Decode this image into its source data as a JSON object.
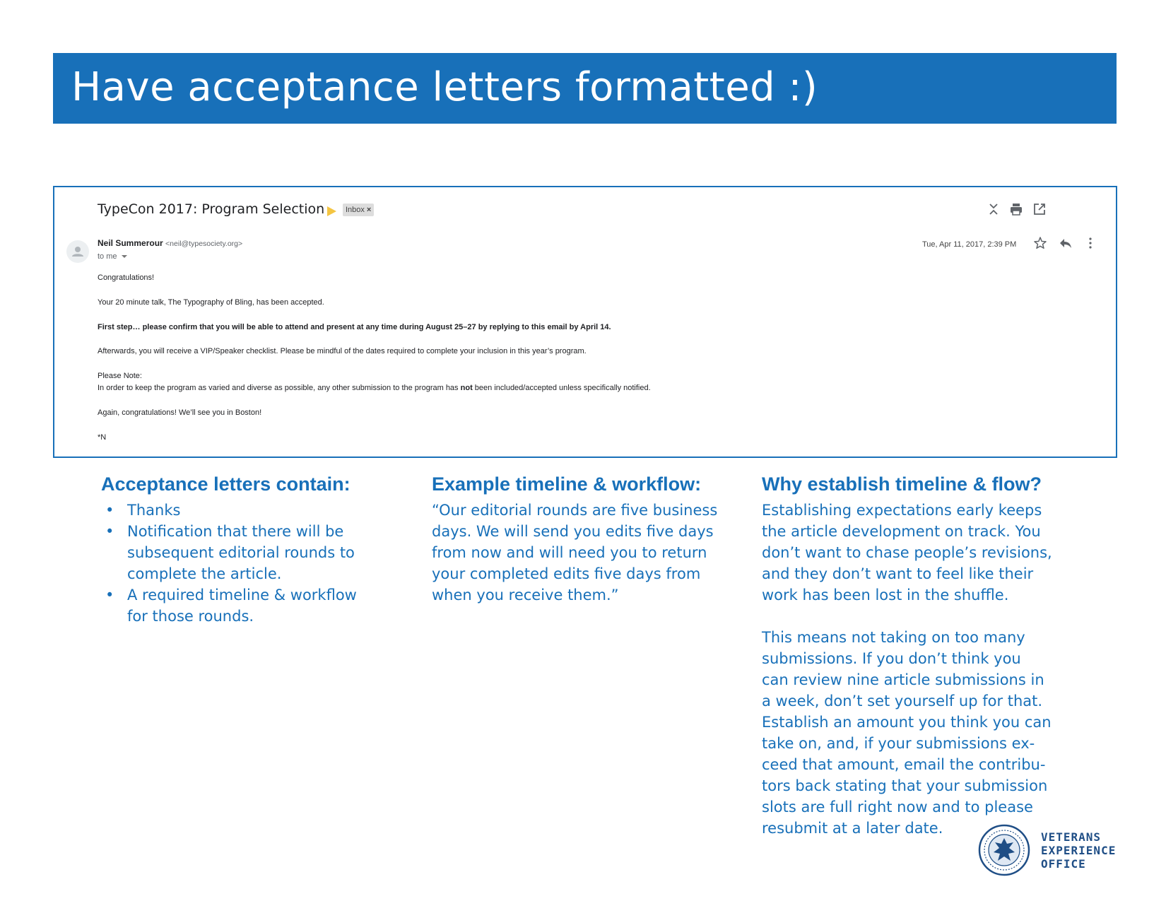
{
  "slide": {
    "title": "Have acceptance letters formatted :)"
  },
  "email": {
    "subject": "TypeCon 2017: Program Selection",
    "label": "Inbox",
    "label_close": "×",
    "sender_name": "Neil Summerour",
    "sender_email": "<neil@typesociety.org>",
    "recipient": "to me",
    "date": "Tue, Apr 11, 2017, 2:39 PM",
    "body": {
      "greeting": "Congratulations!",
      "line1": "Your 20 minute talk, The Typography of Bling, has been accepted.",
      "line2": "First step… please confirm that you will be able to attend and present at any time during August 25–27 by replying to this email by April 14.",
      "line3": "Afterwards, you will receive a VIP/Speaker checklist. Please be mindful of the dates required to complete your inclusion in this year’s program.",
      "note_heading": "Please Note:",
      "note_before": "In order to keep the program as varied and diverse as possible, any other submission to the program has ",
      "note_bold": "not",
      "note_after": " been included/accepted unless specifically notified.",
      "closing": "Again, congratulations! We’ll see you in Boston!",
      "signature": "*N"
    },
    "icons": [
      "collapse-icon",
      "print-icon",
      "open-new-window-icon",
      "star-icon",
      "reply-icon",
      "more-vert-icon",
      "avatar-icon"
    ]
  },
  "columns": {
    "left": {
      "heading": "Acceptance letters contain:",
      "bullet_char": "•",
      "items": [
        {
          "lines": [
            "Thanks"
          ]
        },
        {
          "lines": [
            "Notification that there will be",
            "subsequent editorial rounds to",
            "complete the article."
          ]
        },
        {
          "lines": [
            "A required timeline & workflow",
            "for those rounds."
          ]
        }
      ]
    },
    "middle": {
      "heading": "Example timeline & workflow:",
      "lines": [
        "“Our editorial rounds are five business",
        "days. We will send you edits five days",
        "from now and will need you to return",
        "your completed edits five days from",
        "when you receive them.”"
      ]
    },
    "right": {
      "heading": "Why establish timeline & flow?",
      "para1": [
        "Establishing expectations early keeps",
        "the article development on track. You",
        "don’t want to chase people’s revisions,",
        "and they don’t want to feel like their",
        "work has been lost in the shuffle."
      ],
      "para2": [
        "This means not taking on too many",
        "submissions. If you don’t think you",
        "can review nine article submissions in",
        "a week, don’t set yourself up for that.",
        "Establish an amount you think you can",
        "take on, and, if your submissions ex-",
        "ceed that amount, email the contribu-",
        "tors back stating that your submission",
        "slots are full right now and to please",
        "resubmit at a later date."
      ]
    }
  },
  "logo": {
    "lines": [
      "VETERANS",
      "EXPERIENCE",
      "OFFICE"
    ]
  },
  "colors": {
    "brand_blue": "#1870b9",
    "logo_navy": "#1f4e86",
    "importance_yellow": "#f4c542"
  }
}
